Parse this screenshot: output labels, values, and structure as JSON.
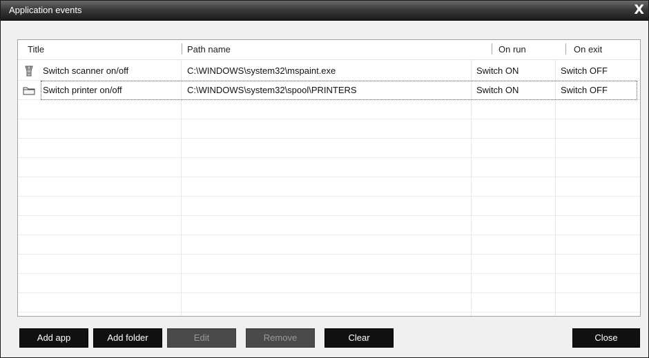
{
  "window": {
    "title": "Application events",
    "close_glyph": "X"
  },
  "columns": [
    "Title",
    "Path name",
    "On run",
    "On exit"
  ],
  "rows": [
    {
      "icon": "scanner-icon",
      "title": "Switch scanner on/off",
      "path": "C:\\WINDOWS\\system32\\mspaint.exe",
      "on_run": "Switch ON",
      "on_exit": "Switch OFF"
    },
    {
      "icon": "folder-icon",
      "title": "Switch printer on/off",
      "path": "C:\\WINDOWS\\system32\\spool\\PRINTERS",
      "on_run": "Switch ON",
      "on_exit": "Switch OFF"
    }
  ],
  "buttons": {
    "add_app": "Add app",
    "add_folder": "Add folder",
    "edit": "Edit",
    "remove": "Remove",
    "clear": "Clear",
    "close": "Close"
  }
}
